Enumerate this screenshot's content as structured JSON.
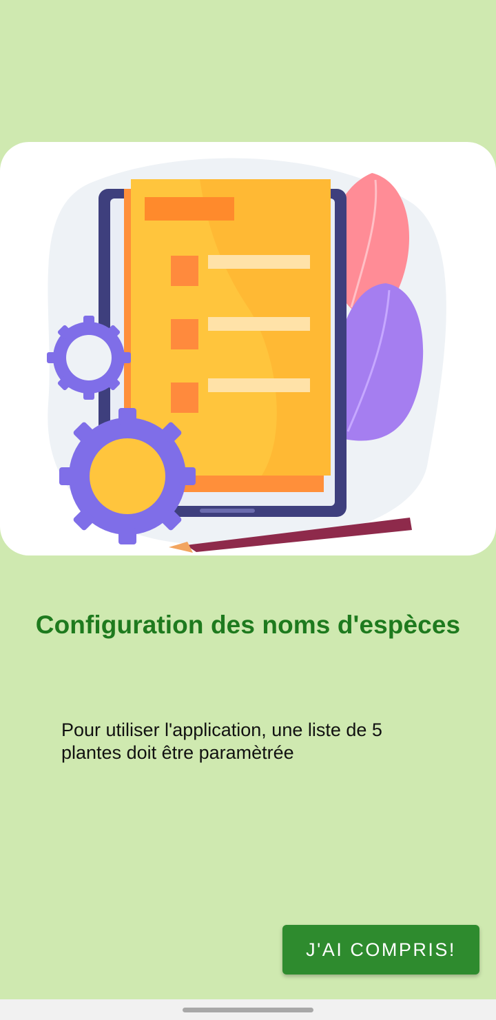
{
  "onboarding": {
    "title": "Configuration des noms d'espèces",
    "description": "Pour utiliser l'application, une liste de 5 plantes doit être paramètrée",
    "button_label": "J'AI COMPRIS!"
  },
  "illustration": {
    "icon": "checklist-document-with-gears-illustration"
  },
  "colors": {
    "background": "#cfe9b0",
    "title": "#1e7a1e",
    "button": "#2e8b2e",
    "gear": "#7f6ee8",
    "document": "#ffc53d"
  }
}
